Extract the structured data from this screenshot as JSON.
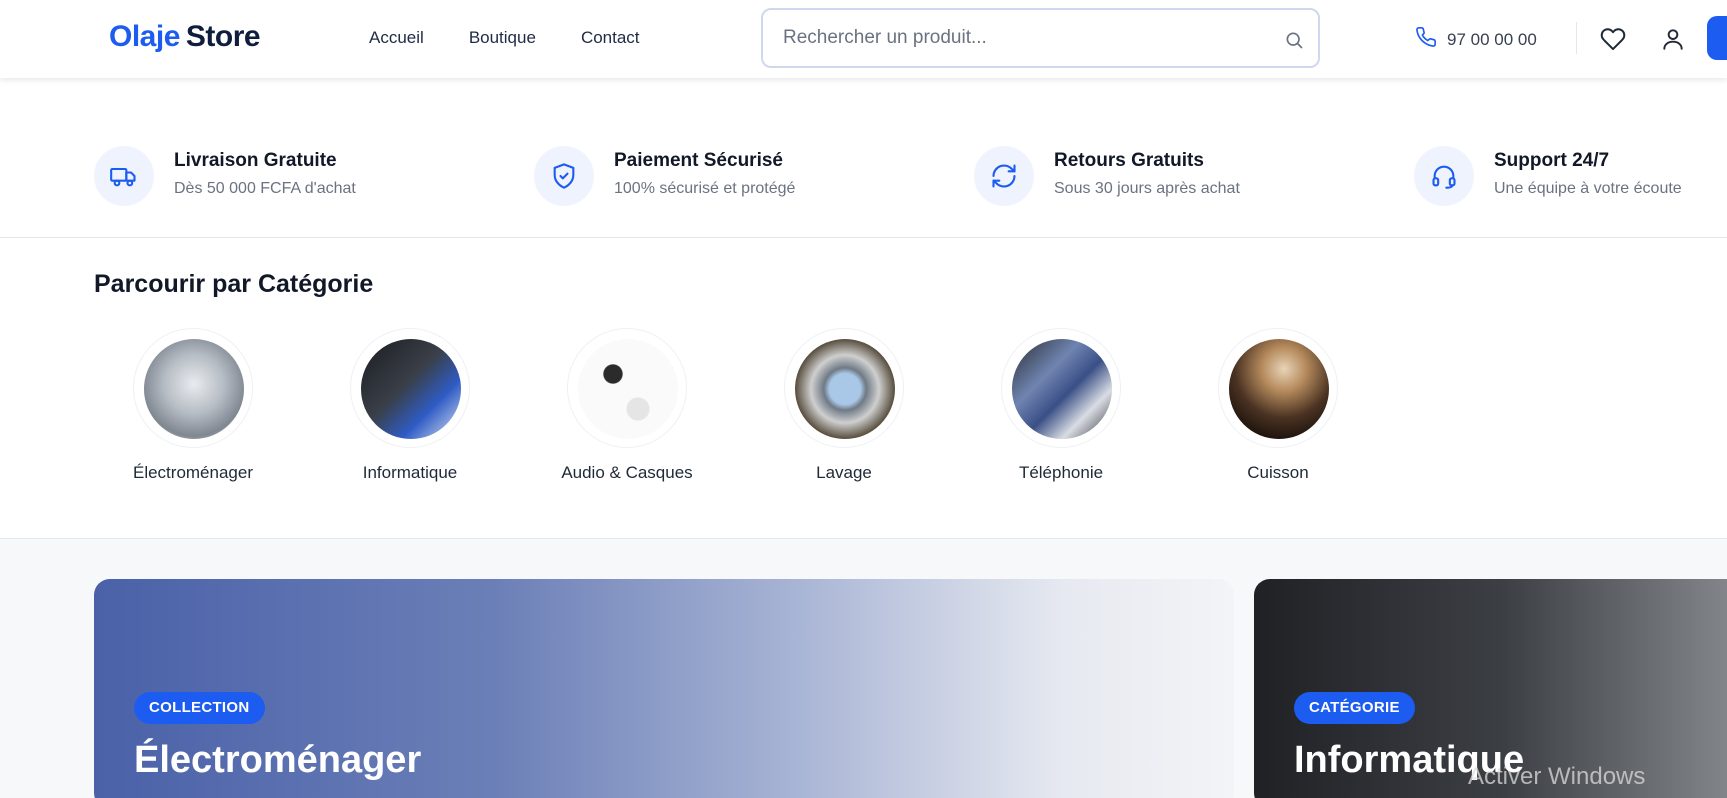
{
  "header": {
    "logo_part1": "Olaje",
    "logo_part2": "Store",
    "nav": [
      {
        "label": "Accueil"
      },
      {
        "label": "Boutique"
      },
      {
        "label": "Contact"
      }
    ],
    "search_placeholder": "Rechercher un produit...",
    "phone": "97 00 00 00"
  },
  "features": [
    {
      "title": "Livraison Gratuite",
      "subtitle": "Dès 50 000 FCFA d'achat",
      "icon": "truck-icon"
    },
    {
      "title": "Paiement Sécurisé",
      "subtitle": "100% sécurisé et protégé",
      "icon": "shield-check-icon"
    },
    {
      "title": "Retours Gratuits",
      "subtitle": "Sous 30 jours après achat",
      "icon": "refresh-icon"
    },
    {
      "title": "Support 24/7",
      "subtitle": "Une équipe à votre écoute",
      "icon": "headset-icon"
    }
  ],
  "categories": {
    "heading": "Parcourir par Catégorie",
    "items": [
      {
        "label": "Électroménager"
      },
      {
        "label": "Informatique"
      },
      {
        "label": "Audio & Casques"
      },
      {
        "label": "Lavage"
      },
      {
        "label": "Téléphonie"
      },
      {
        "label": "Cuisson"
      }
    ]
  },
  "banners": [
    {
      "badge": "COLLECTION",
      "title": "Électroménager"
    },
    {
      "badge": "CATÉGORIE",
      "title": "Informatique"
    }
  ],
  "watermark": "Activer Windows",
  "colors": {
    "accent": "#1d5cf0",
    "dark": "#0f1e3d",
    "feature_circle": "#eef3fe"
  }
}
